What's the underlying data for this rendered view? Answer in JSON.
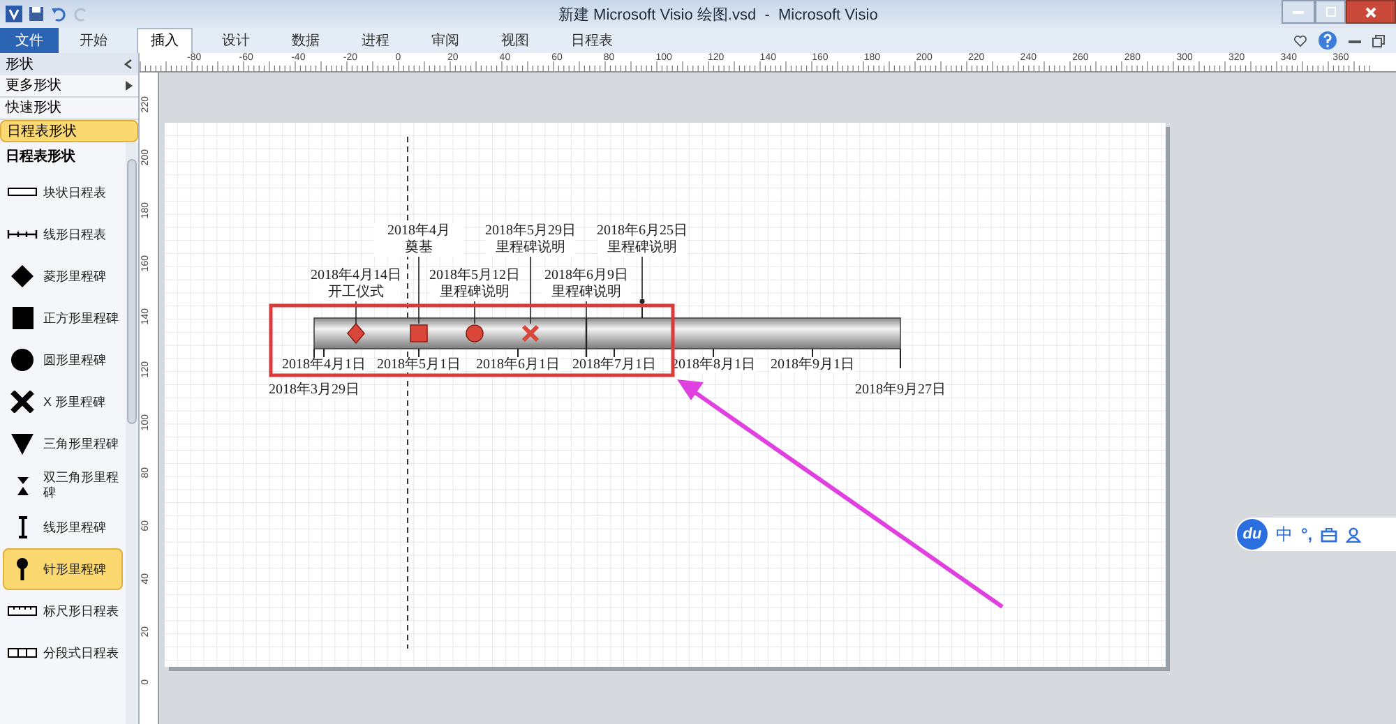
{
  "window": {
    "title": "新建 Microsoft Visio 绘图.vsd  -  Microsoft Visio"
  },
  "ribbon_tabs": [
    {
      "label": "文件",
      "kind": "file",
      "selected": false
    },
    {
      "label": "开始",
      "kind": "tab",
      "selected": false
    },
    {
      "label": "插入",
      "kind": "tab",
      "selected": true
    },
    {
      "label": "设计",
      "kind": "tab",
      "selected": false
    },
    {
      "label": "数据",
      "kind": "tab",
      "selected": false
    },
    {
      "label": "进程",
      "kind": "tab",
      "selected": false
    },
    {
      "label": "审阅",
      "kind": "tab",
      "selected": false
    },
    {
      "label": "视图",
      "kind": "tab",
      "selected": false
    },
    {
      "label": "日程表",
      "kind": "tab",
      "selected": false
    }
  ],
  "shapes_panel": {
    "title": "形状",
    "sections": [
      {
        "label": "更多形状",
        "kind": "submenu",
        "selected": false
      },
      {
        "label": "快速形状",
        "kind": "stencil",
        "selected": false
      },
      {
        "label": "日程表形状",
        "kind": "stencil",
        "selected": true
      }
    ],
    "stencil_title": "日程表形状",
    "items": [
      {
        "label": "块状日程表",
        "kind": "block",
        "selected": false
      },
      {
        "label": "线形日程表",
        "kind": "line",
        "selected": false
      },
      {
        "label": "菱形里程碑",
        "kind": "diamond",
        "selected": false
      },
      {
        "label": "正方形里程碑",
        "kind": "square",
        "selected": false
      },
      {
        "label": "圆形里程碑",
        "kind": "circle",
        "selected": false
      },
      {
        "label": "X 形里程碑",
        "kind": "x",
        "selected": false
      },
      {
        "label": "三角形里程碑",
        "kind": "triangle",
        "selected": false
      },
      {
        "label": "双三角形里程碑",
        "kind": "double-triangle",
        "selected": false
      },
      {
        "label": "线形里程碑",
        "kind": "bar",
        "selected": false
      },
      {
        "label": "针形里程碑",
        "kind": "pin",
        "selected": true
      },
      {
        "label": "标尺形日程表",
        "kind": "ruler",
        "selected": false
      },
      {
        "label": "分段式日程表",
        "kind": "segments",
        "selected": false
      }
    ]
  },
  "ruler": {
    "horizontal": [
      "-80",
      "-60",
      "-40",
      "-20",
      "0",
      "20",
      "40",
      "60",
      "80",
      "100",
      "120",
      "140",
      "160",
      "180",
      "200",
      "220",
      "240",
      "260",
      "280",
      "300",
      "320",
      "340",
      "360"
    ],
    "vertical": [
      "220",
      "200",
      "180",
      "160",
      "140",
      "120",
      "100",
      "80",
      "60",
      "40",
      "20",
      "0"
    ]
  },
  "timeline": {
    "axis_labels": [
      {
        "text": "2018年4月1日",
        "kind": "month"
      },
      {
        "text": "2018年5月1日",
        "kind": "month"
      },
      {
        "text": "2018年6月1日",
        "kind": "month"
      },
      {
        "text": "2018年7月1日",
        "kind": "month"
      },
      {
        "text": "2018年8月1日",
        "kind": "month"
      },
      {
        "text": "2018年9月1日",
        "kind": "month"
      },
      {
        "text": "2018年3月29日",
        "kind": "start"
      },
      {
        "text": "2018年9月27日",
        "kind": "end"
      }
    ],
    "milestones": [
      {
        "kind": "diamond",
        "date": "2018年4月14日",
        "description": "开工仪式"
      },
      {
        "kind": "square",
        "date": "2018年4月",
        "description": "奠基"
      },
      {
        "kind": "circle",
        "date": "2018年5月12日",
        "description": "里程碑说明"
      },
      {
        "kind": "x",
        "date": "2018年5月29日",
        "description": "里程碑说明"
      },
      {
        "kind": "line",
        "date": "2018年6月9日",
        "description": "里程碑说明"
      },
      {
        "kind": "pin",
        "date": "2018年6月25日",
        "description": "里程碑说明"
      }
    ]
  },
  "ime_toolbar": {
    "logo": "du",
    "mode": "中",
    "punctuation": "°,"
  }
}
